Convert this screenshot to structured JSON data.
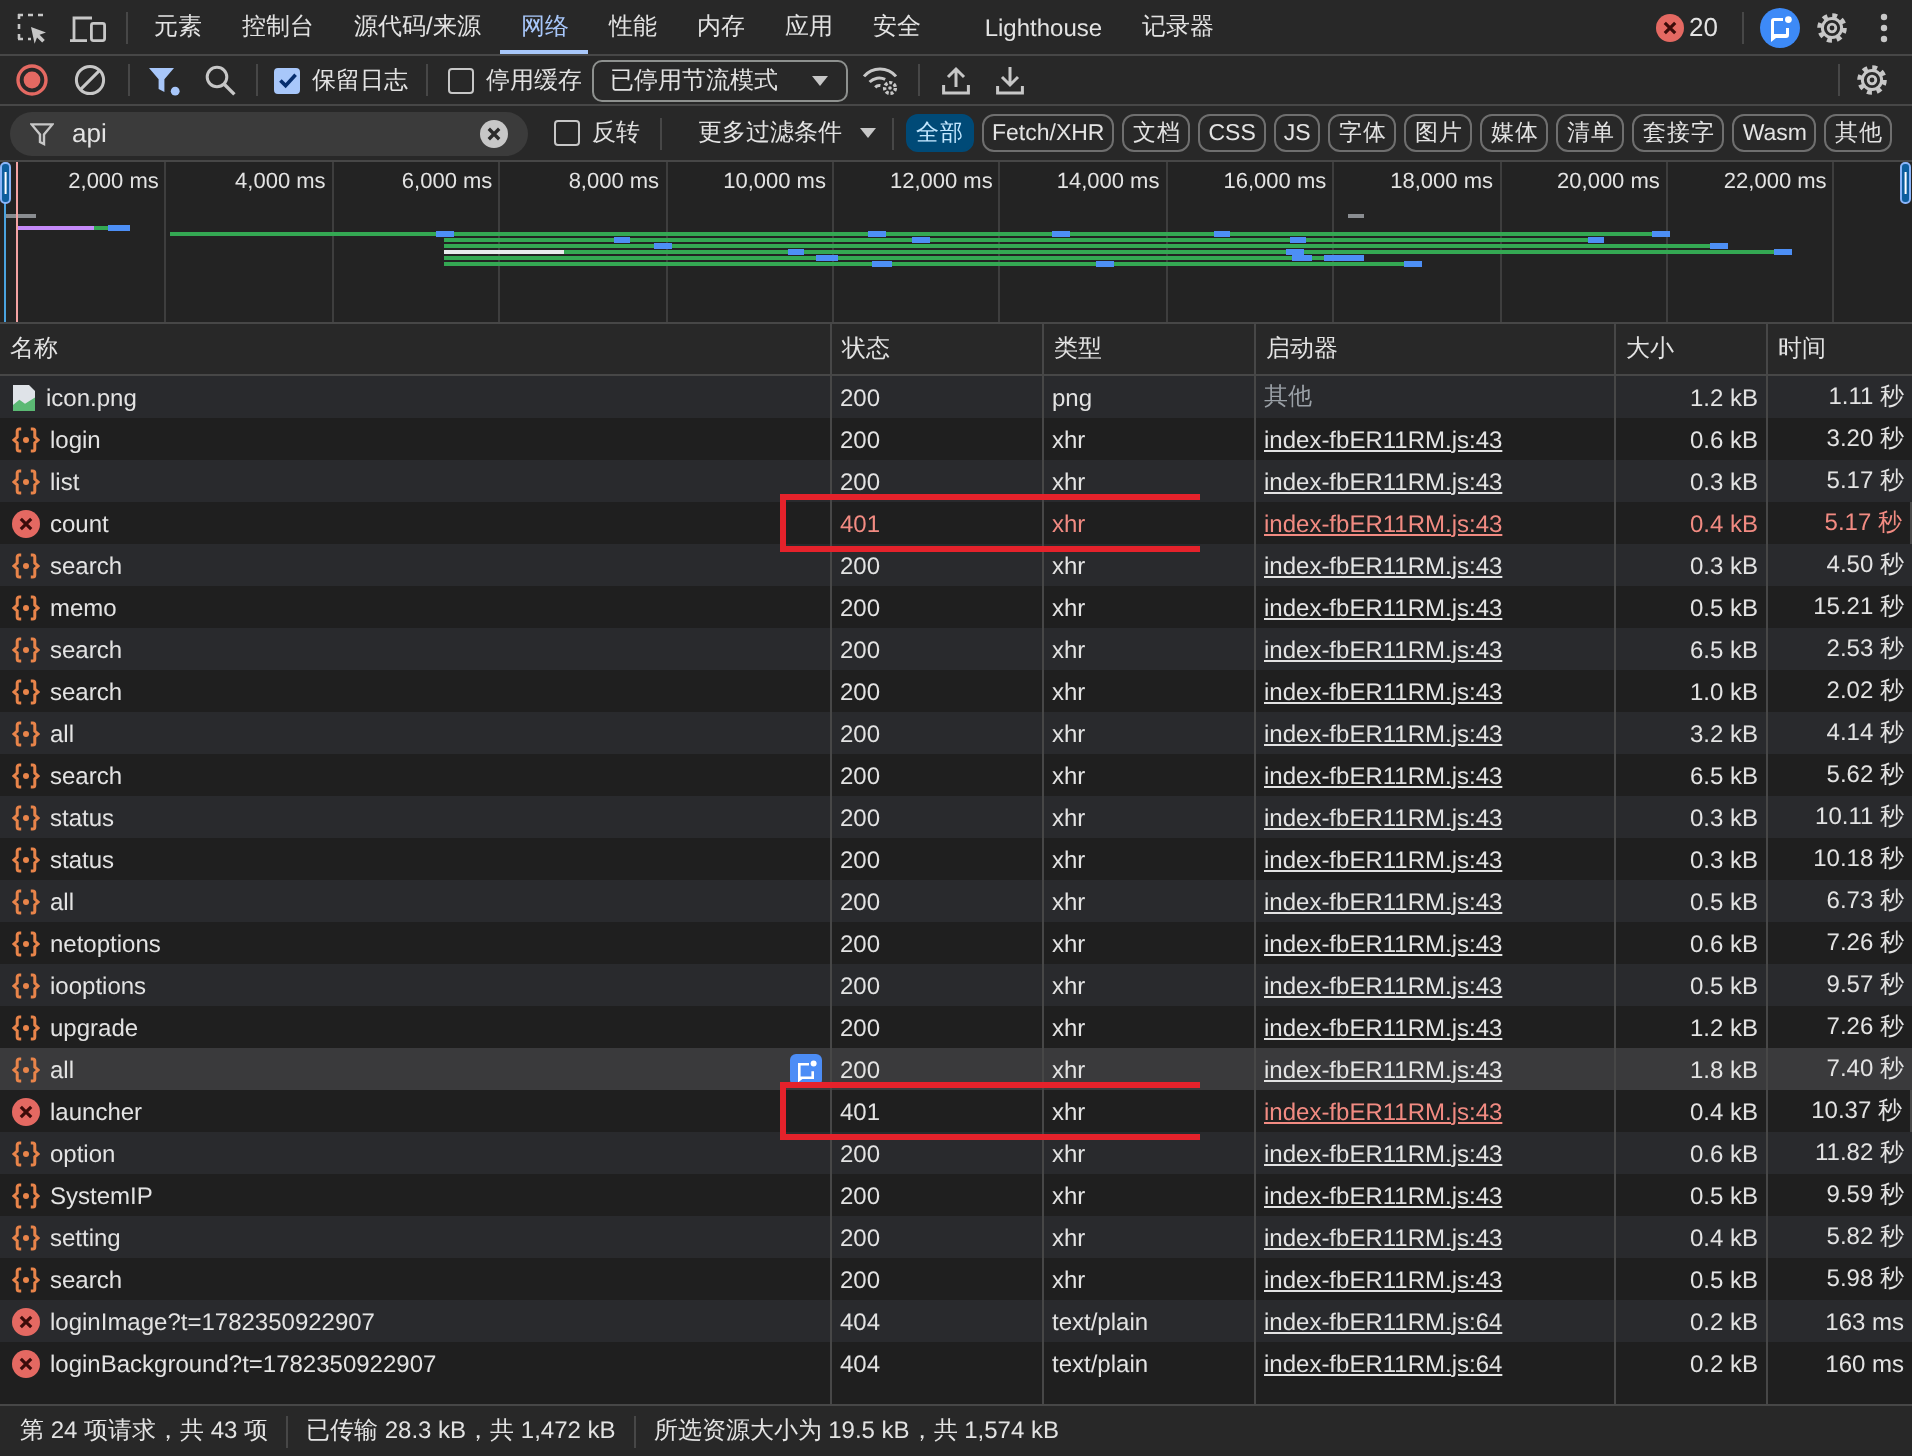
{
  "panel_tabs": [
    {
      "label": "元素",
      "selected": false
    },
    {
      "label": "控制台",
      "selected": false
    },
    {
      "label": "源代码/来源",
      "selected": false
    },
    {
      "label": "网络",
      "selected": true
    },
    {
      "label": "性能",
      "selected": false
    },
    {
      "label": "内存",
      "selected": false
    },
    {
      "label": "应用",
      "selected": false
    },
    {
      "label": "安全",
      "selected": false
    },
    {
      "label": "Lighthouse",
      "selected": false
    },
    {
      "label": "记录器",
      "selected": false
    }
  ],
  "error_count": "20",
  "toolbar": {
    "recording": true,
    "preserve_log": {
      "label": "保留日志",
      "checked": true
    },
    "disable_cache": {
      "label": "停用缓存",
      "checked": false
    },
    "throttling": "已停用节流模式"
  },
  "filter": {
    "value": "api",
    "invert": {
      "label": "反转",
      "checked": false
    },
    "more_filters": "更多过滤条件",
    "types": [
      {
        "label": "全部",
        "selected": true
      },
      {
        "label": "Fetch/XHR",
        "selected": false
      },
      {
        "label": "文档",
        "selected": false
      },
      {
        "label": "CSS",
        "selected": false
      },
      {
        "label": "JS",
        "selected": false
      },
      {
        "label": "字体",
        "selected": false
      },
      {
        "label": "图片",
        "selected": false
      },
      {
        "label": "媒体",
        "selected": false
      },
      {
        "label": "清单",
        "selected": false
      },
      {
        "label": "套接字",
        "selected": false
      },
      {
        "label": "Wasm",
        "selected": false
      },
      {
        "label": "其他",
        "selected": false
      }
    ]
  },
  "overview": {
    "ticks": [
      "2,000 ms",
      "4,000 ms",
      "6,000 ms",
      "8,000 ms",
      "10,000 ms",
      "12,000 ms",
      "14,000 ms",
      "16,000 ms",
      "18,000 ms",
      "20,000 ms",
      "22,000 ms"
    ]
  },
  "table": {
    "columns": [
      "名称",
      "状态",
      "类型",
      "启动器",
      "大小",
      "时间"
    ],
    "rows": [
      {
        "kind": "image",
        "name": "icon.png",
        "status": "200",
        "type": "png",
        "initiator": "其他",
        "initiator_link": false,
        "initiator_error": false,
        "size": "1.2 kB",
        "time": "1.11 秒",
        "error": false,
        "highlighted": false,
        "annotated": false
      },
      {
        "kind": "fetch",
        "name": "login",
        "status": "200",
        "type": "xhr",
        "initiator": "index-fbER11RM.js:43",
        "initiator_link": true,
        "initiator_error": false,
        "size": "0.6 kB",
        "time": "3.20 秒",
        "error": false,
        "highlighted": false,
        "annotated": false
      },
      {
        "kind": "fetch",
        "name": "list",
        "status": "200",
        "type": "xhr",
        "initiator": "index-fbER11RM.js:43",
        "initiator_link": true,
        "initiator_error": false,
        "size": "0.3 kB",
        "time": "5.17 秒",
        "error": false,
        "highlighted": false,
        "annotated": false
      },
      {
        "kind": "failed",
        "name": "count",
        "status": "401",
        "type": "xhr",
        "initiator": "index-fbER11RM.js:43",
        "initiator_link": true,
        "initiator_error": true,
        "size": "0.4 kB",
        "time": "5.17 秒",
        "error": true,
        "highlighted": false,
        "annotated": true
      },
      {
        "kind": "fetch",
        "name": "search",
        "status": "200",
        "type": "xhr",
        "initiator": "index-fbER11RM.js:43",
        "initiator_link": true,
        "initiator_error": false,
        "size": "0.3 kB",
        "time": "4.50 秒",
        "error": false,
        "highlighted": false,
        "annotated": false
      },
      {
        "kind": "fetch",
        "name": "memo",
        "status": "200",
        "type": "xhr",
        "initiator": "index-fbER11RM.js:43",
        "initiator_link": true,
        "initiator_error": false,
        "size": "0.5 kB",
        "time": "15.21 秒",
        "error": false,
        "highlighted": false,
        "annotated": false
      },
      {
        "kind": "fetch",
        "name": "search",
        "status": "200",
        "type": "xhr",
        "initiator": "index-fbER11RM.js:43",
        "initiator_link": true,
        "initiator_error": false,
        "size": "6.5 kB",
        "time": "2.53 秒",
        "error": false,
        "highlighted": false,
        "annotated": false
      },
      {
        "kind": "fetch",
        "name": "search",
        "status": "200",
        "type": "xhr",
        "initiator": "index-fbER11RM.js:43",
        "initiator_link": true,
        "initiator_error": false,
        "size": "1.0 kB",
        "time": "2.02 秒",
        "error": false,
        "highlighted": false,
        "annotated": false
      },
      {
        "kind": "fetch",
        "name": "all",
        "status": "200",
        "type": "xhr",
        "initiator": "index-fbER11RM.js:43",
        "initiator_link": true,
        "initiator_error": false,
        "size": "3.2 kB",
        "time": "4.14 秒",
        "error": false,
        "highlighted": false,
        "annotated": false
      },
      {
        "kind": "fetch",
        "name": "search",
        "status": "200",
        "type": "xhr",
        "initiator": "index-fbER11RM.js:43",
        "initiator_link": true,
        "initiator_error": false,
        "size": "6.5 kB",
        "time": "5.62 秒",
        "error": false,
        "highlighted": false,
        "annotated": false
      },
      {
        "kind": "fetch",
        "name": "status",
        "status": "200",
        "type": "xhr",
        "initiator": "index-fbER11RM.js:43",
        "initiator_link": true,
        "initiator_error": false,
        "size": "0.3 kB",
        "time": "10.11 秒",
        "error": false,
        "highlighted": false,
        "annotated": false
      },
      {
        "kind": "fetch",
        "name": "status",
        "status": "200",
        "type": "xhr",
        "initiator": "index-fbER11RM.js:43",
        "initiator_link": true,
        "initiator_error": false,
        "size": "0.3 kB",
        "time": "10.18 秒",
        "error": false,
        "highlighted": false,
        "annotated": false
      },
      {
        "kind": "fetch",
        "name": "all",
        "status": "200",
        "type": "xhr",
        "initiator": "index-fbER11RM.js:43",
        "initiator_link": true,
        "initiator_error": false,
        "size": "0.5 kB",
        "time": "6.73 秒",
        "error": false,
        "highlighted": false,
        "annotated": false
      },
      {
        "kind": "fetch",
        "name": "netoptions",
        "status": "200",
        "type": "xhr",
        "initiator": "index-fbER11RM.js:43",
        "initiator_link": true,
        "initiator_error": false,
        "size": "0.6 kB",
        "time": "7.26 秒",
        "error": false,
        "highlighted": false,
        "annotated": false
      },
      {
        "kind": "fetch",
        "name": "iooptions",
        "status": "200",
        "type": "xhr",
        "initiator": "index-fbER11RM.js:43",
        "initiator_link": true,
        "initiator_error": false,
        "size": "0.5 kB",
        "time": "9.57 秒",
        "error": false,
        "highlighted": false,
        "annotated": false
      },
      {
        "kind": "fetch",
        "name": "upgrade",
        "status": "200",
        "type": "xhr",
        "initiator": "index-fbER11RM.js:43",
        "initiator_link": true,
        "initiator_error": false,
        "size": "1.2 kB",
        "time": "7.26 秒",
        "error": false,
        "highlighted": false,
        "annotated": false
      },
      {
        "kind": "fetch",
        "name": "all",
        "status": "200",
        "type": "xhr",
        "initiator": "index-fbER11RM.js:43",
        "initiator_link": true,
        "initiator_error": false,
        "size": "1.8 kB",
        "time": "7.40 秒",
        "error": false,
        "highlighted": true,
        "annotated": false
      },
      {
        "kind": "failed",
        "name": "launcher",
        "status": "401",
        "type": "xhr",
        "initiator": "index-fbER11RM.js:43",
        "initiator_link": true,
        "initiator_error": true,
        "size": "0.4 kB",
        "time": "10.37 秒",
        "error": false,
        "highlighted": false,
        "annotated": true
      },
      {
        "kind": "fetch",
        "name": "option",
        "status": "200",
        "type": "xhr",
        "initiator": "index-fbER11RM.js:43",
        "initiator_link": true,
        "initiator_error": false,
        "size": "0.6 kB",
        "time": "11.82 秒",
        "error": false,
        "highlighted": false,
        "annotated": false
      },
      {
        "kind": "fetch",
        "name": "SystemIP",
        "status": "200",
        "type": "xhr",
        "initiator": "index-fbER11RM.js:43",
        "initiator_link": true,
        "initiator_error": false,
        "size": "0.5 kB",
        "time": "9.59 秒",
        "error": false,
        "highlighted": false,
        "annotated": false
      },
      {
        "kind": "fetch",
        "name": "setting",
        "status": "200",
        "type": "xhr",
        "initiator": "index-fbER11RM.js:43",
        "initiator_link": true,
        "initiator_error": false,
        "size": "0.4 kB",
        "time": "5.82 秒",
        "error": false,
        "highlighted": false,
        "annotated": false
      },
      {
        "kind": "fetch",
        "name": "search",
        "status": "200",
        "type": "xhr",
        "initiator": "index-fbER11RM.js:43",
        "initiator_link": true,
        "initiator_error": false,
        "size": "0.5 kB",
        "time": "5.98 秒",
        "error": false,
        "highlighted": false,
        "annotated": false
      },
      {
        "kind": "failed",
        "name": "loginImage?t=1782350922907",
        "status": "404",
        "type": "text/plain",
        "initiator": "index-fbER11RM.js:64",
        "initiator_link": true,
        "initiator_error": false,
        "size": "0.2 kB",
        "time": "163 ms",
        "error": false,
        "highlighted": false,
        "annotated": false
      },
      {
        "kind": "failed",
        "name": "loginBackground?t=1782350922907",
        "status": "404",
        "type": "text/plain",
        "initiator": "index-fbER11RM.js:64",
        "initiator_link": true,
        "initiator_error": false,
        "size": "0.2 kB",
        "time": "160 ms",
        "error": false,
        "highlighted": false,
        "annotated": false
      }
    ]
  },
  "status_bar": [
    "第 24 项请求，共 43 项",
    "已传输 28.3 kB，共 1,472 kB",
    "所选资源大小为 19.5 kB，共 1,574 kB"
  ]
}
